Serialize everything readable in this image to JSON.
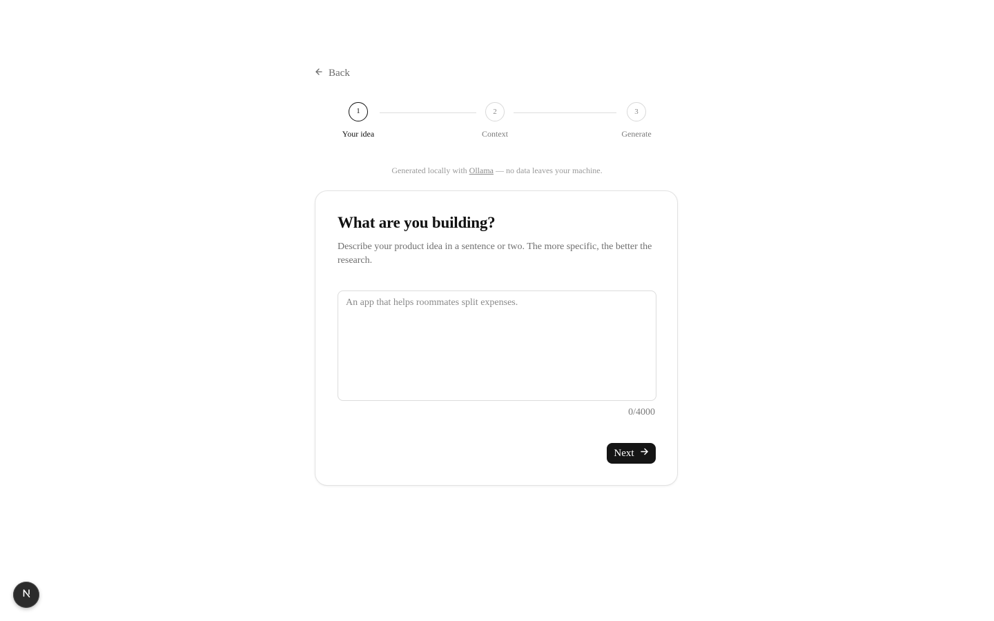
{
  "nav": {
    "back_label": "Back",
    "back_icon": "arrow-left-icon"
  },
  "stepper": {
    "steps": [
      {
        "number": "1",
        "label": "Your idea",
        "active": true
      },
      {
        "number": "2",
        "label": "Context",
        "active": false
      },
      {
        "number": "3",
        "label": "Generate",
        "active": false
      }
    ]
  },
  "privacy": {
    "prefix": "Generated locally with ",
    "link_text": "Ollama",
    "suffix": " — no data leaves your machine."
  },
  "card": {
    "title": "What are you building?",
    "description": "Describe your product idea in a sentence or two. The more specific, the better the research.",
    "input": {
      "value": "",
      "placeholder": "An app that helps roommates split expenses."
    },
    "char_count": "0/4000",
    "next_label": "Next",
    "next_icon": "arrow-right-icon"
  },
  "dev_badge": {
    "letter": "N",
    "icon": "nextjs-logo-icon"
  },
  "colors": {
    "primary": "#151515",
    "text": "#111111",
    "muted": "#6f6f6f",
    "border": "#e2e2e2"
  }
}
